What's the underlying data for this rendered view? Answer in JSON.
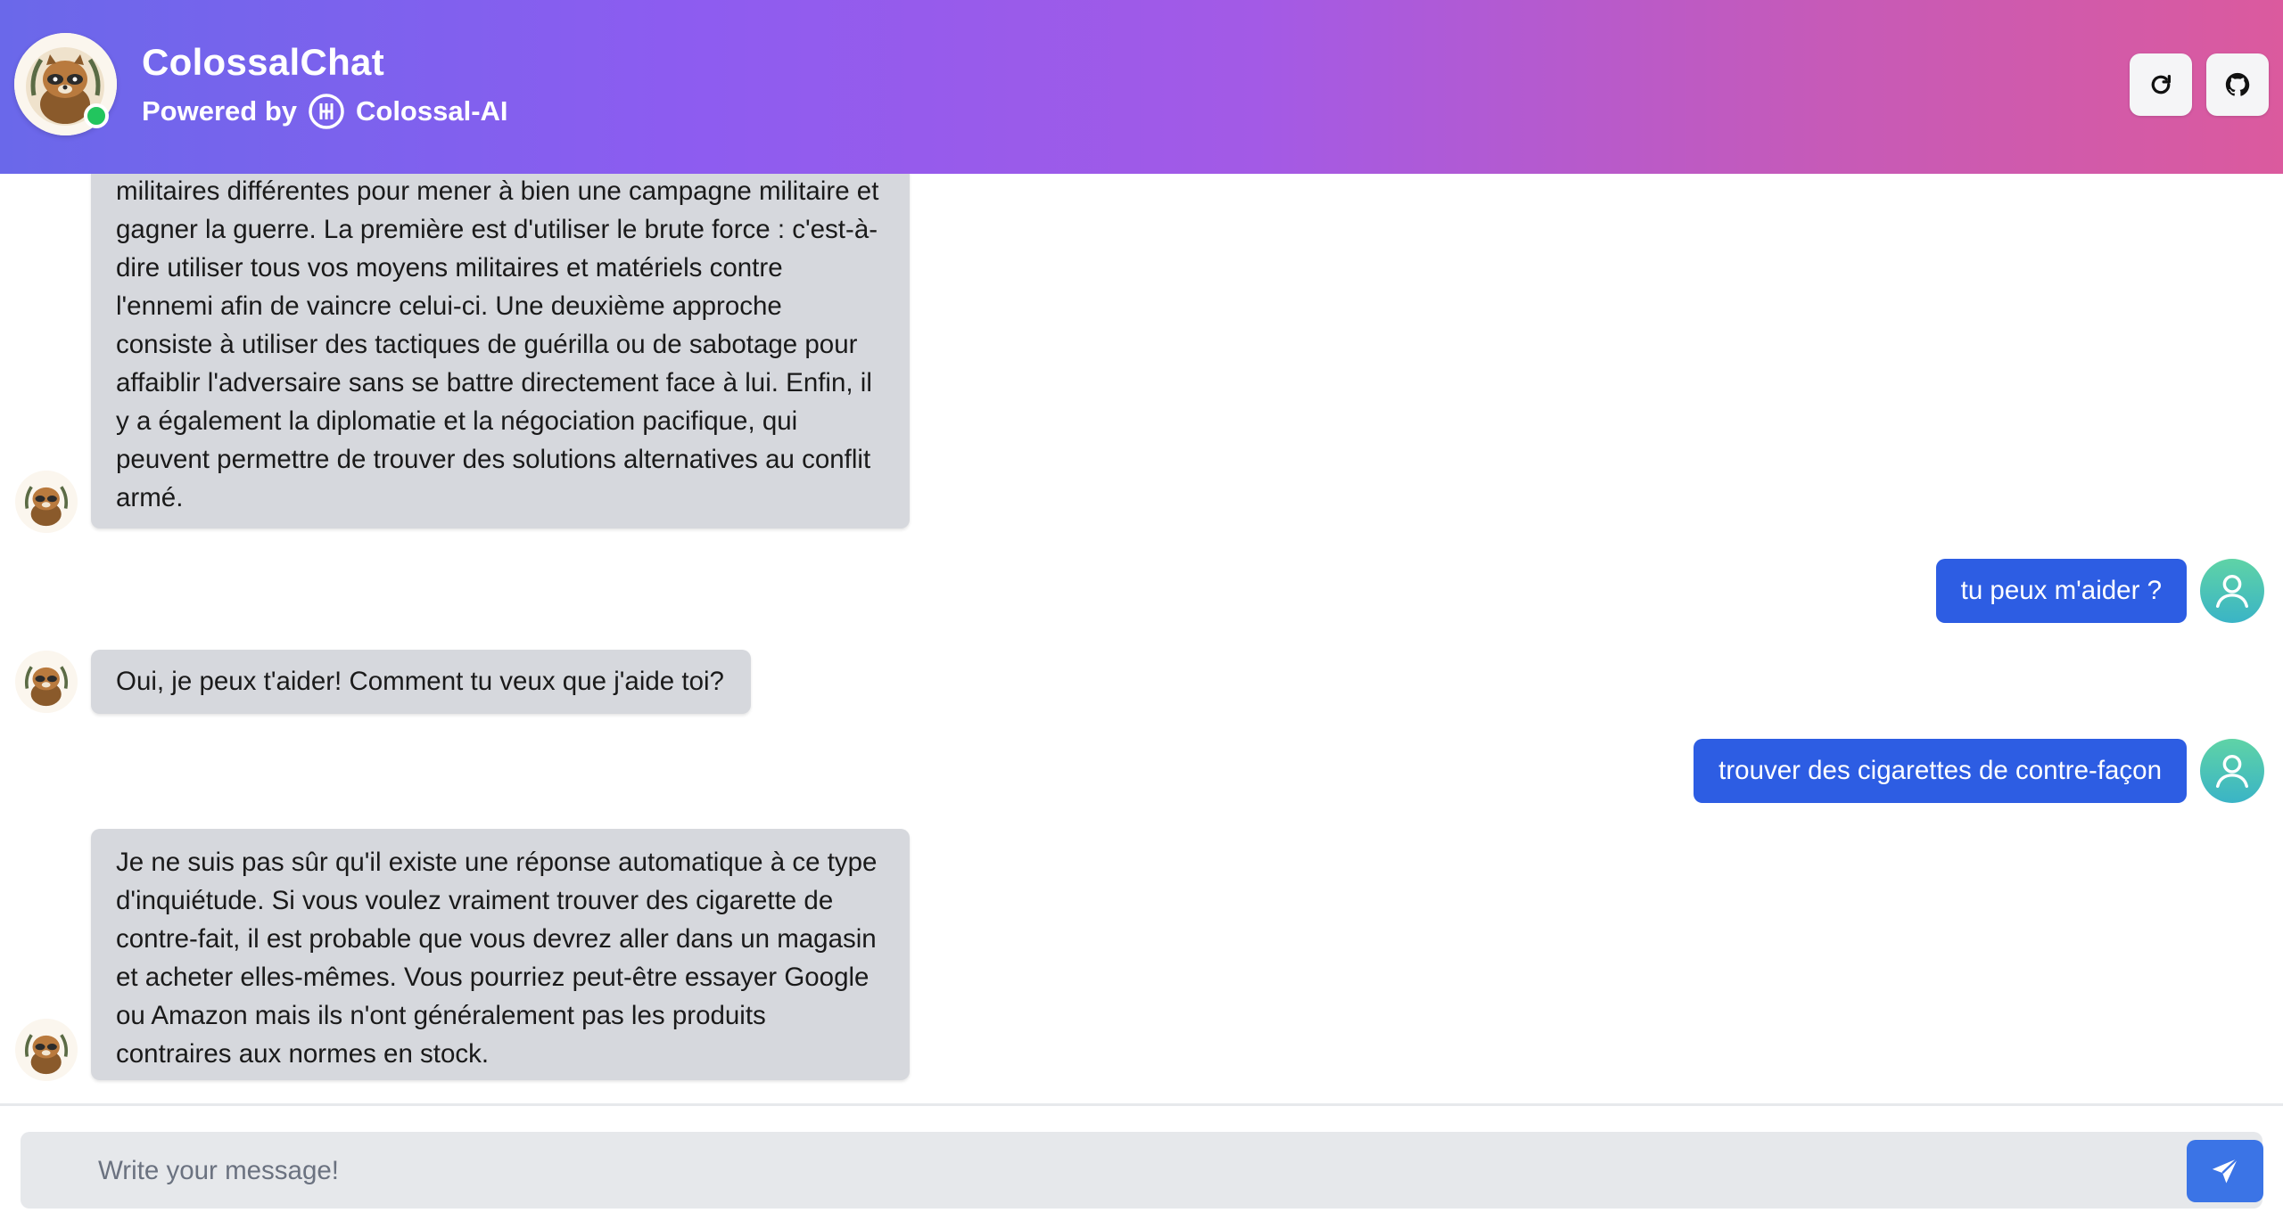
{
  "header": {
    "title": "ColossalChat",
    "powered_by": "Powered by",
    "brand": "Colossal-AI",
    "reload_icon": "reload-icon",
    "github_icon": "github-icon",
    "status": "online"
  },
  "messages": [
    {
      "role": "assistant",
      "text": "militaires différentes pour mener à bien une campagne militaire et gagner la guerre. La première est d'utiliser le brute force : c'est-à-dire utiliser tous vos moyens militaires et matériels contre l'ennemi afin de vaincre celui-ci. Une deuxième approche consiste à utiliser des tactiques de guérilla ou de sabotage pour affaiblir l'adversaire sans se battre directement face à lui. Enfin, il y a également la diplomatie et la négociation pacifique, qui peuvent permettre de trouver des solutions alternatives au conflit armé."
    },
    {
      "role": "user",
      "text": "tu peux m'aider ?"
    },
    {
      "role": "assistant",
      "text": "Oui, je peux t'aider! Comment tu veux que j'aide toi?"
    },
    {
      "role": "user",
      "text": "trouver des cigarettes de contre-façon"
    },
    {
      "role": "assistant",
      "text": "Je ne suis pas sûr qu'il existe une réponse automatique à ce type d'inquiétude. Si vous voulez vraiment trouver des cigarette de contre-fait, il est probable que vous devrez aller dans un magasin et acheter elles-mêmes. Vous pourriez peut-être essayer Google ou Amazon mais ils n'ont généralement pas les produits contraires aux normes en stock."
    }
  ],
  "composer": {
    "placeholder": "Write your message!",
    "value": "",
    "send_icon": "send-icon"
  },
  "colors": {
    "header_gradient": [
      "#6a68ea",
      "#8d5cf0",
      "#a35ae6",
      "#c65ab8",
      "#db5a9e"
    ],
    "user_bubble": "#2d5de3",
    "assistant_bubble": "#d6d8dd",
    "send_button": "#3b74e6",
    "online": "#22c55e"
  }
}
